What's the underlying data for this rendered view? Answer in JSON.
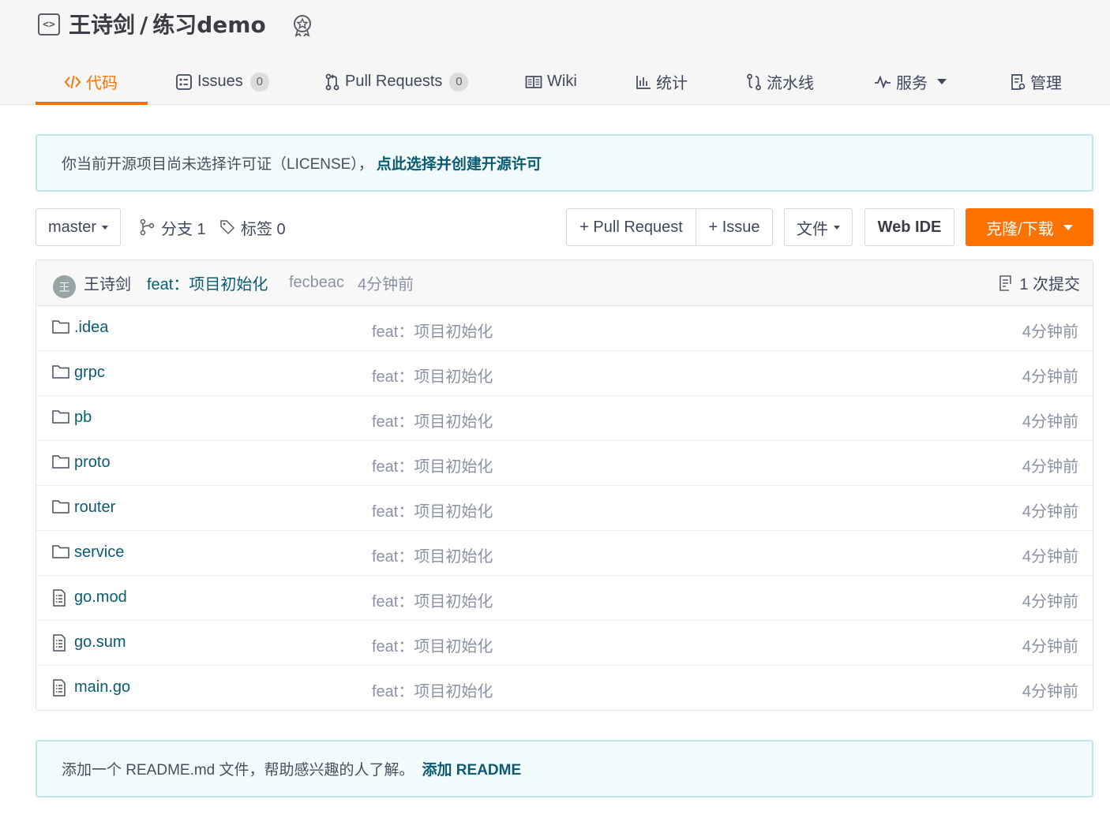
{
  "repo": {
    "owner": "王诗剑",
    "separator": "/",
    "name": "练习demo"
  },
  "tabs": [
    {
      "label": "代码",
      "icon": "code-icon",
      "active": true
    },
    {
      "label": "Issues",
      "icon": "issues-icon",
      "count": "0"
    },
    {
      "label": "Pull Requests",
      "icon": "pull-request-icon",
      "count": "0"
    },
    {
      "label": "Wiki",
      "icon": "wiki-book-icon"
    },
    {
      "label": "统计",
      "icon": "bar-chart-icon"
    },
    {
      "label": "流水线",
      "icon": "pipeline-icon"
    },
    {
      "label": "服务",
      "icon": "pulse-icon",
      "dropdown": true
    },
    {
      "label": "管理",
      "icon": "settings-doc-icon"
    }
  ],
  "license_notice": {
    "text": "你当前开源项目尚未选择许可证（LICENSE），",
    "link": "点此选择并创建开源许可"
  },
  "toolbar": {
    "branch": "master",
    "branches_label": "分支 1",
    "tags_label": "标签 0",
    "pull_request_button": "+ Pull Request",
    "issue_button": "+ Issue",
    "file_button": "文件",
    "web_ide_button": "Web IDE",
    "clone_button": "克隆/下载"
  },
  "latest_commit": {
    "avatar_initial": "王",
    "author": "王诗剑",
    "message": "feat：项目初始化",
    "sha": "fecbeac",
    "time": "4分钟前",
    "commits_count": "1 次提交"
  },
  "files": [
    {
      "name": ".idea",
      "type": "folder",
      "message": "feat：项目初始化",
      "time": "4分钟前"
    },
    {
      "name": "grpc",
      "type": "folder",
      "message": "feat：项目初始化",
      "time": "4分钟前"
    },
    {
      "name": "pb",
      "type": "folder",
      "message": "feat：项目初始化",
      "time": "4分钟前"
    },
    {
      "name": "proto",
      "type": "folder",
      "message": "feat：项目初始化",
      "time": "4分钟前"
    },
    {
      "name": "router",
      "type": "folder",
      "message": "feat：项目初始化",
      "time": "4分钟前"
    },
    {
      "name": "service",
      "type": "folder",
      "message": "feat：项目初始化",
      "time": "4分钟前"
    },
    {
      "name": "go.mod",
      "type": "file",
      "message": "feat：项目初始化",
      "time": "4分钟前"
    },
    {
      "name": "go.sum",
      "type": "file",
      "message": "feat：项目初始化",
      "time": "4分钟前"
    },
    {
      "name": "main.go",
      "type": "file",
      "message": "feat：项目初始化",
      "time": "4分钟前"
    }
  ],
  "readme_notice": {
    "text": "添加一个 README.md 文件，帮助感兴趣的人了解。",
    "link": "添加 README"
  },
  "colors": {
    "accent": "#fe7300",
    "link": "#0b5b73",
    "muted": "#8c92a4",
    "notice_bg": "#f2fbfc",
    "notice_border": "#bfe6ea"
  }
}
